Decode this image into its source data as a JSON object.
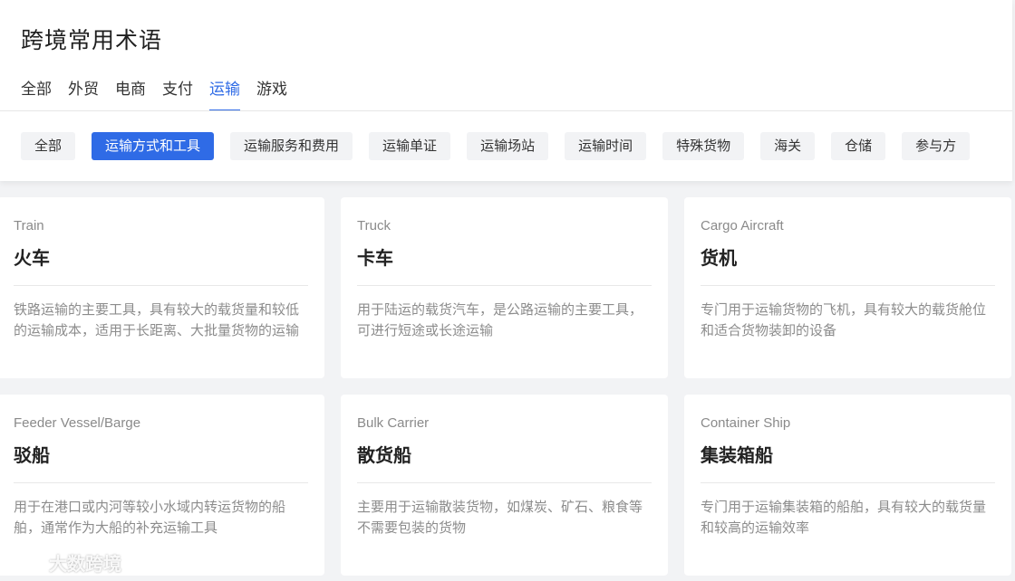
{
  "page": {
    "title": "跨境常用术语"
  },
  "tabs": [
    {
      "label": "全部"
    },
    {
      "label": "外贸"
    },
    {
      "label": "电商"
    },
    {
      "label": "支付"
    },
    {
      "label": "运输",
      "active": true
    },
    {
      "label": "游戏"
    }
  ],
  "chips": [
    {
      "label": "全部"
    },
    {
      "label": "运输方式和工具",
      "active": true
    },
    {
      "label": "运输服务和费用"
    },
    {
      "label": "运输单证"
    },
    {
      "label": "运输场站"
    },
    {
      "label": "运输时间"
    },
    {
      "label": "特殊货物"
    },
    {
      "label": "海关"
    },
    {
      "label": "仓储"
    },
    {
      "label": "参与方"
    }
  ],
  "cards": [
    {
      "en": "Train",
      "cn": "火车",
      "desc": "铁路运输的主要工具，具有较大的载货量和较低的运输成本，适用于长距离、大批量货物的运输"
    },
    {
      "en": "Truck",
      "cn": "卡车",
      "desc": "用于陆运的载货汽车，是公路运输的主要工具，可进行短途或长途运输"
    },
    {
      "en": "Cargo Aircraft",
      "cn": "货机",
      "desc": "专门用于运输货物的飞机，具有较大的载货舱位和适合货物装卸的设备"
    },
    {
      "en": "Feeder Vessel/Barge",
      "cn": "驳船",
      "desc": "用于在港口或内河等较小水域内转运货物的船舶，通常作为大船的补充运输工具"
    },
    {
      "en": "Bulk Carrier",
      "cn": "散货船",
      "desc": "主要用于运输散装货物，如煤炭、矿石、粮食等不需要包装的货物"
    },
    {
      "en": "Container Ship",
      "cn": "集装箱船",
      "desc": "专门用于运输集装箱的船舶，具有较大的载货量和较高的运输效率"
    }
  ],
  "watermark": {
    "text": "大数跨境",
    "icon": "brand-logo-icon"
  },
  "colors": {
    "accent": "#2f6be6",
    "background": "#f2f3f5"
  }
}
